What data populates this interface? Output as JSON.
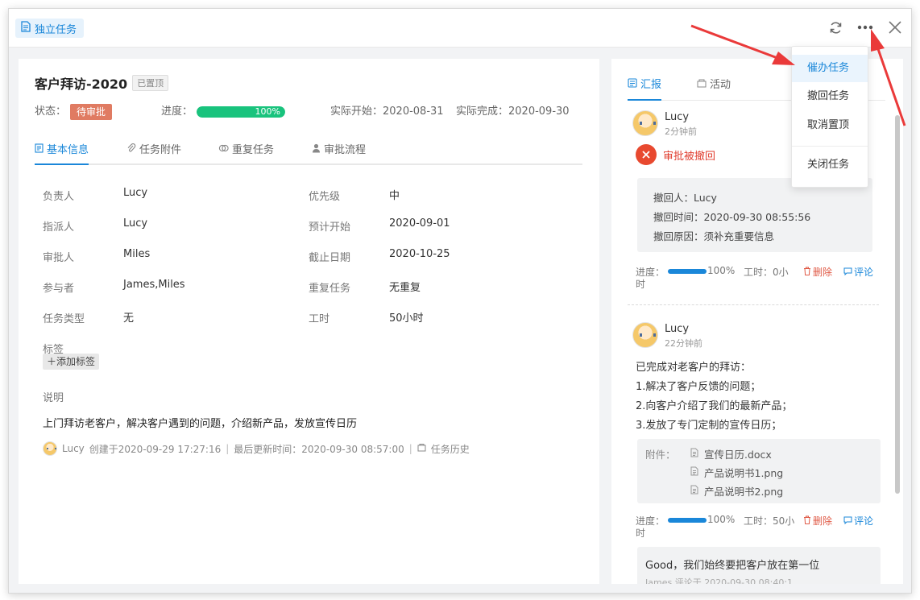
{
  "header": {
    "task_type_label": "独立任务"
  },
  "task": {
    "title": "客户拜访-2020",
    "pinned_badge": "已置顶",
    "status_label": "状态：",
    "status_value": "待审批",
    "status_color": "#e07b62",
    "progress_label": "进度：",
    "progress_value": 100,
    "progress_text": "100%",
    "progress_color": "#19c37d",
    "actual_start": "实际开始：2020-08-31",
    "actual_end": "实际完成：2020-09-30"
  },
  "tabs": [
    {
      "label": "基本信息",
      "icon": "document-icon"
    },
    {
      "label": "任务附件",
      "icon": "paperclip-icon"
    },
    {
      "label": "重复任务",
      "icon": "repeat-icon"
    },
    {
      "label": "审批流程",
      "icon": "user-icon"
    }
  ],
  "fields": [
    {
      "label": "负责人",
      "value": "Lucy"
    },
    {
      "label": "优先级",
      "value": "中"
    },
    {
      "label": "指派人",
      "value": "Lucy"
    },
    {
      "label": "预计开始",
      "value": "2020-09-01"
    },
    {
      "label": "审批人",
      "value": "Miles"
    },
    {
      "label": "截止日期",
      "value": "2020-10-25"
    },
    {
      "label": "参与者",
      "value": "James,Miles"
    },
    {
      "label": "重复任务",
      "value": "无重复"
    },
    {
      "label": "任务类型",
      "value": "无"
    },
    {
      "label": "工时",
      "value": "50小时"
    }
  ],
  "tags": {
    "label": "标签",
    "add_button": "添加标签"
  },
  "description": {
    "label": "说明",
    "text": "上门拜访老客户，解决客户遇到的问题，介绍新产品，发放宣传日历"
  },
  "meta": {
    "author": "Lucy",
    "created": "创建于2020-09-29 17:27:16",
    "updated": "最后更新时间：2020-09-30 08:57:00",
    "history_link": "任务历史"
  },
  "right_tabs": [
    {
      "label": "汇报",
      "icon": "report-icon"
    },
    {
      "label": "活动",
      "icon": "activity-icon"
    }
  ],
  "reports": [
    {
      "user": "Lucy",
      "time": "2分钟前",
      "status": "审批被撤回",
      "details": [
        "撤回人：Lucy",
        "撤回时间：2020-09-30 08:55:56",
        "撤回原因：须补充重要信息"
      ],
      "progress_label": "进度：",
      "progress_text": "100%",
      "hours_text": "工时：0小",
      "hours_text_wrap": "时",
      "delete_label": "删除",
      "comment_label": "评论"
    },
    {
      "user": "Lucy",
      "time": "22分钟前",
      "lines": [
        "已完成对老客户的拜访：",
        "1.解决了客户反馈的问题；",
        "2.向客户介绍了我们的最新产品；",
        "3.发放了专门定制的宣传日历；"
      ],
      "attachments_label": "附件：",
      "attachments": [
        "宣传日历.docx",
        "产品说明书1.png",
        "产品说明书2.png"
      ],
      "progress_label": "进度：",
      "progress_text": "100%",
      "hours_text": "工时：50小",
      "hours_text_wrap": "时",
      "delete_label": "删除",
      "comment_label": "评论",
      "comment_text": "Good，我们始终要把客户放在第一位",
      "comment_meta": "James 评论于 2020-09-30 08:40:1"
    }
  ],
  "dropdown_menu": [
    "催办任务",
    "撤回任务",
    "取消置顶",
    "关闭任务"
  ],
  "colors": {
    "accent": "#1a87d9",
    "danger": "#e03d2e",
    "arrow": "#ea3a3a"
  }
}
